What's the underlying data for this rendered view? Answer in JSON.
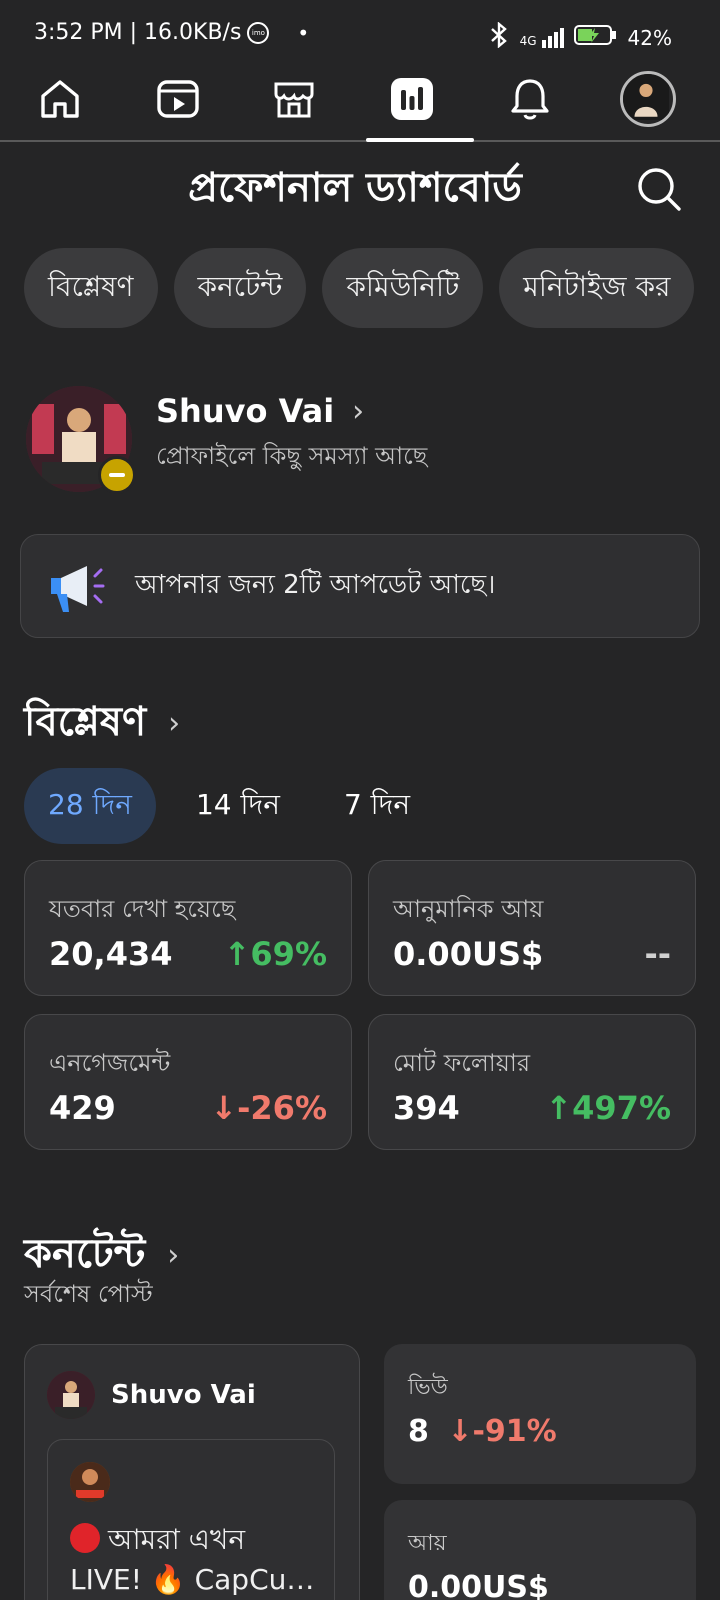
{
  "status_bar": {
    "time_speed": "3:52 PM | 16.0KB/s",
    "network": "4G",
    "battery": "42%"
  },
  "nav": {
    "items": [
      "home",
      "reels",
      "marketplace",
      "professional-dashboard",
      "notifications",
      "profile"
    ],
    "active": "professional-dashboard"
  },
  "header": {
    "title": "প্রফেশনাল ড্যাশবোর্ড"
  },
  "chips": [
    "বিশ্লেষণ",
    "কনটেন্ট",
    "কমিউনিটি",
    "মনিটাইজ কর"
  ],
  "profile": {
    "name": "Shuvo Vai",
    "subtitle": "প্রোফাইলে কিছু সমস্যা আছে"
  },
  "update_banner": {
    "text": "আপনার জন্য 2টি আপডেট আছে।"
  },
  "analytics": {
    "title": "বিশ্লেষণ",
    "ranges": [
      "28 দিন",
      "14 দিন",
      "7 দিন"
    ],
    "active_range": "28 দিন",
    "stats": [
      {
        "label": "যতবার দেখা হয়েছে",
        "value": "20,434",
        "change": "↑69%",
        "trend": "up"
      },
      {
        "label": "আনুমানিক আয়",
        "value": "0.00US$",
        "change": "--",
        "trend": "neutral"
      },
      {
        "label": "এনগেজমেন্ট",
        "value": "429",
        "change": "↓-26%",
        "trend": "down"
      },
      {
        "label": "মোট ফলোয়ার",
        "value": "394",
        "change": "↑497%",
        "trend": "up"
      }
    ]
  },
  "content": {
    "title": "কনটেন্ট",
    "subtitle": "সর্বশেষ পোস্ট",
    "post": {
      "author": "Shuvo Vai",
      "text": "আমরা এখন LIVE! 🔥 CapCu…"
    },
    "metrics": [
      {
        "label": "ভিউ",
        "value": "8",
        "change": "↓-91%",
        "trend": "down"
      },
      {
        "label": "আয়",
        "value": "0.00US$"
      }
    ]
  },
  "colors": {
    "background": "#252526",
    "card": "#2f2f31",
    "accent_blue": "#6fa9ff",
    "up_green": "#45bd62",
    "down_red": "#f07a6c"
  }
}
